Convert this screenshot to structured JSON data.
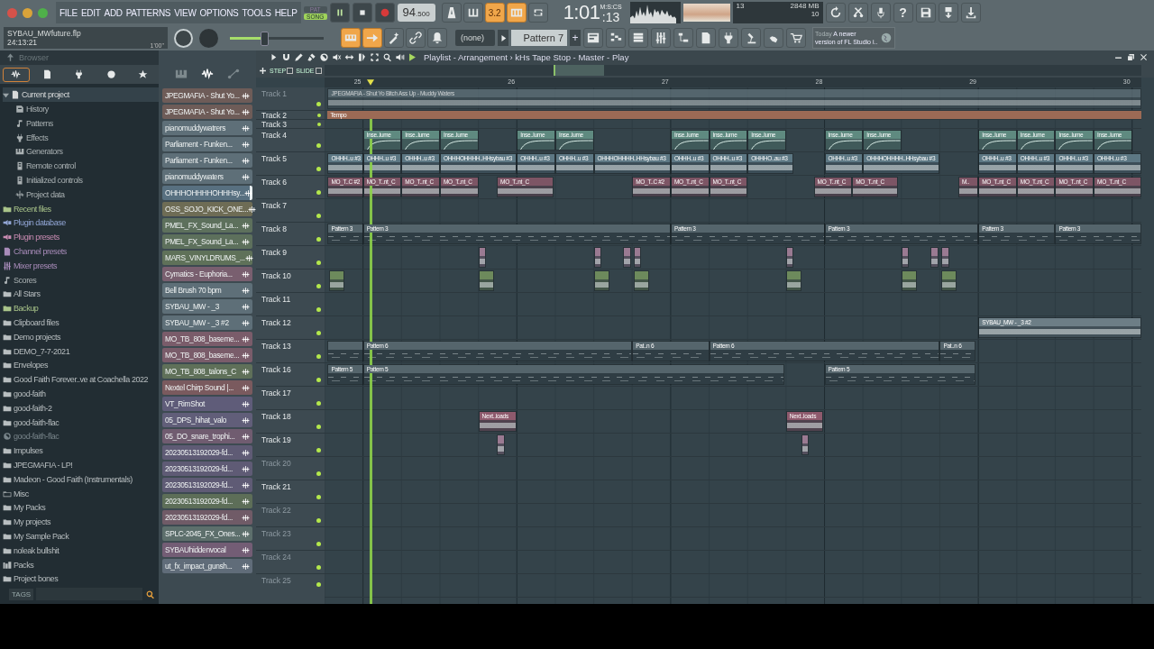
{
  "menu": [
    "FILE",
    "EDIT",
    "ADD",
    "PATTERNS",
    "VIEW",
    "OPTIONS",
    "TOOLS",
    "HELP"
  ],
  "mode_switch": [
    {
      "label": "PAT",
      "selected": false
    },
    {
      "label": "SONG",
      "selected": true
    }
  ],
  "transport": {
    "playing": true,
    "tempo_whole": "94",
    "tempo_fraction": ".500"
  },
  "transport_toggles": [
    {
      "kind": "metronome",
      "on": false
    },
    {
      "kind": "wait",
      "on": false
    },
    {
      "kind": "countdown",
      "label": "3.2",
      "on": true
    },
    {
      "kind": "step-edit",
      "on": true
    },
    {
      "kind": "loop-record",
      "on": false
    }
  ],
  "song_time": {
    "main": "1:01",
    "sub": ":13",
    "unit": "M:S:CS"
  },
  "monitor": {
    "cpu": "13",
    "memory": "2848 MB",
    "polyphony": "10"
  },
  "help_label": "?",
  "project": {
    "file": "SYBAU_MWfuture.flp",
    "time": "24:13:21",
    "length": "1'00\""
  },
  "master_pitch": {
    "level": 0.37
  },
  "record_toggles": [
    {
      "kind": "keyboard",
      "on": true
    },
    {
      "kind": "arrow",
      "on": true
    },
    {
      "kind": "wand",
      "on": false
    },
    {
      "kind": "link",
      "on": false
    },
    {
      "kind": "bell",
      "on": false
    }
  ],
  "pattern_picker": {
    "none_label": "(none)",
    "pattern": "Pattern 7",
    "add": "+"
  },
  "news": {
    "day": "Today",
    "text": "A newer version of FL Studio i.."
  },
  "browser": {
    "title": "Browser",
    "tags_label": "TAGS",
    "items": [
      {
        "label": "Current project",
        "kind": "project",
        "expanded": true,
        "children": [
          {
            "label": "History",
            "kind": "history"
          },
          {
            "label": "Patterns",
            "kind": "note"
          },
          {
            "label": "Effects",
            "kind": "plug"
          },
          {
            "label": "Generators",
            "kind": "keys"
          },
          {
            "label": "Remote control",
            "kind": "remote"
          },
          {
            "label": "Initialized controls",
            "kind": "remote"
          },
          {
            "label": "Project data",
            "kind": "data"
          }
        ]
      },
      {
        "label": "Recent files",
        "kind": "folder-green"
      },
      {
        "label": "Plugin database",
        "kind": "plugin-db"
      },
      {
        "label": "Plugin presets",
        "kind": "plugin-preset"
      },
      {
        "label": "Channel presets",
        "kind": "channel-preset"
      },
      {
        "label": "Mixer presets",
        "kind": "mixer-preset"
      },
      {
        "label": "Scores",
        "kind": "note"
      },
      {
        "label": "All Stars",
        "kind": "folder"
      },
      {
        "label": "Backup",
        "kind": "folder-green"
      },
      {
        "label": "Clipboard files",
        "kind": "folder"
      },
      {
        "label": "Demo projects",
        "kind": "folder"
      },
      {
        "label": "DEMO_7-7-2021",
        "kind": "folder"
      },
      {
        "label": "Envelopes",
        "kind": "folder"
      },
      {
        "label": "Good Faith Forever..ve at Coachella 2022",
        "kind": "folder"
      },
      {
        "label": "good-faith",
        "kind": "folder"
      },
      {
        "label": "good-faith-2",
        "kind": "folder"
      },
      {
        "label": "good-faith-flac",
        "kind": "folder"
      },
      {
        "label": "good-faith-flac",
        "kind": "missing"
      },
      {
        "label": "Impulses",
        "kind": "folder"
      },
      {
        "label": "JPEGMAFIA - LP!",
        "kind": "folder"
      },
      {
        "label": "Madeon - Good Faith (Instrumentals)",
        "kind": "folder"
      },
      {
        "label": "Misc",
        "kind": "folder-plain"
      },
      {
        "label": "My Packs",
        "kind": "folder"
      },
      {
        "label": "My projects",
        "kind": "folder"
      },
      {
        "label": "My Sample Pack",
        "kind": "folder"
      },
      {
        "label": "noleak bullshit",
        "kind": "folder"
      },
      {
        "label": "Packs",
        "kind": "packs"
      },
      {
        "label": "Project bones",
        "kind": "folder"
      }
    ]
  },
  "channels": [
    {
      "name": "JPEGMAFIA - Shut Yo...",
      "color": "#6e5c58",
      "selected": false
    },
    {
      "name": "JPEGMAFIA - Shut Yo...",
      "color": "#6e5c58",
      "selected": false
    },
    {
      "name": "pianomuddywatrers",
      "color": "#5e6f78",
      "selected": false
    },
    {
      "name": "Parliament - Funken...",
      "color": "#5e6f78",
      "selected": false
    },
    {
      "name": "Parliament - Funken...",
      "color": "#5e6f78",
      "selected": false
    },
    {
      "name": "pianomuddywaters",
      "color": "#5e6f78",
      "selected": false
    },
    {
      "name": "OHHHOHHHHOHHHsy...",
      "color": "#587080",
      "selected": true
    },
    {
      "name": "OSS_SOJO_KICK_ONE...",
      "color": "#6e6c55",
      "selected": false
    },
    {
      "name": "PMEL_FX_Sound_La...",
      "color": "#5d705c",
      "selected": false
    },
    {
      "name": "PMEL_FX_Sound_La...",
      "color": "#5d705c",
      "selected": false
    },
    {
      "name": "MARS_VINYLDRUMS_...",
      "color": "#5f7159",
      "selected": false
    },
    {
      "name": "Cymatics - Euphoria...",
      "color": "#795f6f",
      "selected": false
    },
    {
      "name": "Bell Brush 70 bpm",
      "color": "#5e6f78",
      "selected": false
    },
    {
      "name": "SYBAU_MW - _3",
      "color": "#5e6f78",
      "selected": false
    },
    {
      "name": "SYBAU_MW - _3 #2",
      "color": "#5e6f78",
      "selected": false
    },
    {
      "name": "MO_TB_808_baseme...",
      "color": "#7a5c6a",
      "selected": false
    },
    {
      "name": "MO_TB_808_baseme...",
      "color": "#7a5c6a",
      "selected": false
    },
    {
      "name": "MO_TB_808_talons_C",
      "color": "#5f7059",
      "selected": false
    },
    {
      "name": "Nextel Chirp Sound |...",
      "color": "#7a5a5e",
      "selected": false
    },
    {
      "name": "VT_RimShot",
      "color": "#5f5c79",
      "selected": false
    },
    {
      "name": "05_DPS_hihat_valo",
      "color": "#615e79",
      "selected": false
    },
    {
      "name": "05_DO_snare_trophi...",
      "color": "#705c70",
      "selected": false
    },
    {
      "name": "20230513192029-fd...",
      "color": "#5f5b75",
      "selected": false
    },
    {
      "name": "20230513192029-fd...",
      "color": "#5f5b75",
      "selected": false
    },
    {
      "name": "20230513192029-fd...",
      "color": "#5f5b75",
      "selected": false
    },
    {
      "name": "20230513192029-fd...",
      "color": "#5d6e58",
      "selected": false
    },
    {
      "name": "20230513192029-fd...",
      "color": "#705b67",
      "selected": false
    },
    {
      "name": "SPLC-2045_FX_Ones...",
      "color": "#5d6f6c",
      "selected": false
    },
    {
      "name": "SYBAUhiddenvocal",
      "color": "#735d75",
      "selected": false
    },
    {
      "name": "ut_fx_impact_gunsh...",
      "color": "#606c79",
      "selected": false
    }
  ],
  "playlist": {
    "title": "Playlist - Arrangement › kHs Tape Stop - Master - Play",
    "options": [
      {
        "label": "STEP",
        "checked": false
      },
      {
        "label": "SLIDE",
        "checked": false
      }
    ],
    "ruler": [
      "25",
      "26",
      "27",
      "28",
      "29",
      "30"
    ],
    "tracks": [
      {
        "name": "Track 1",
        "kind": "normal",
        "muted": true,
        "clips": [
          {
            "kind": "audio",
            "label": "JPEGMAFIA - Shut Yo Bitch Ass Up - Muddy Waters",
            "color": "#5f7179"
          }
        ]
      },
      {
        "name": "Track 2",
        "kind": "small",
        "muted": false,
        "clips": [
          {
            "kind": "automation",
            "label": "Tempo",
            "color": "#9c6a55"
          }
        ]
      },
      {
        "name": "Track 3",
        "kind": "small",
        "muted": false
      },
      {
        "name": "Track 4",
        "kind": "normal",
        "muted": false,
        "clips": [
          {
            "kind": "automation",
            "label": "Inse..lume",
            "color": "#5f8a80"
          },
          {
            "kind": "automation",
            "label": "Inse..lume",
            "color": "#5f8a80"
          },
          {
            "kind": "automation",
            "label": "Inse..lume",
            "color": "#5f8a80"
          },
          {
            "kind": "automation",
            "label": "Inse..lume",
            "color": "#5f8a80"
          },
          {
            "kind": "automation",
            "label": "Inse..lume",
            "color": "#5f8a80"
          },
          {
            "kind": "automation",
            "label": "Inse..lume",
            "color": "#5f8a80"
          },
          {
            "kind": "automation",
            "label": "Inse..lume",
            "color": "#5f8a80"
          },
          {
            "kind": "automation",
            "label": "Inse..lume",
            "color": "#5f8a80"
          },
          {
            "kind": "automation",
            "label": "Inse..lume",
            "color": "#5f8a80"
          },
          {
            "kind": "automation",
            "label": "Inse..lume",
            "color": "#5f8a80"
          },
          {
            "kind": "automation",
            "label": "Inse..lume",
            "color": "#5f8a80"
          },
          {
            "kind": "automation",
            "label": "Inse..lume",
            "color": "#5f8a80"
          },
          {
            "kind": "automation",
            "label": "Inse..lume",
            "color": "#5f8a80"
          },
          {
            "kind": "automation",
            "label": "Inse..lume",
            "color": "#5f8a80"
          }
        ]
      },
      {
        "name": "Track 5",
        "kind": "normal",
        "muted": false,
        "clips": [
          {
            "kind": "audio",
            "label": "OHHH..u #3",
            "color": "#5d7884"
          },
          {
            "kind": "audio",
            "label": "OHHH..u #3",
            "color": "#5d7884"
          },
          {
            "kind": "audio",
            "label": "OHHH..u #3",
            "color": "#5d7884"
          },
          {
            "kind": "audio",
            "label": "OHHHOHHHH..HHsybau #3",
            "color": "#5d7884"
          },
          {
            "kind": "audio",
            "label": "OHHH..u #3",
            "color": "#5d7884"
          },
          {
            "kind": "audio",
            "label": "OHHH..u #3",
            "color": "#5d7884"
          },
          {
            "kind": "audio",
            "label": "OHHHOHHHH..HHsybau #3",
            "color": "#5d7884"
          },
          {
            "kind": "audio",
            "label": "OHHH..u #3",
            "color": "#5d7884"
          },
          {
            "kind": "audio",
            "label": "OHHH..u #3",
            "color": "#5d7884"
          },
          {
            "kind": "audio",
            "label": "OHHHO..au #3",
            "color": "#5d7884"
          },
          {
            "kind": "audio",
            "label": "OHHH..u #3",
            "color": "#5d7884"
          },
          {
            "kind": "audio",
            "label": "OHHHOHHHH..HHsybau #3",
            "color": "#5d7884"
          },
          {
            "kind": "audio",
            "label": "OHHH..u #3",
            "color": "#5d7884"
          },
          {
            "kind": "audio",
            "label": "OHHH..u #3",
            "color": "#5d7884"
          },
          {
            "kind": "audio",
            "label": "OHHH..u #3",
            "color": "#5d7884"
          },
          {
            "kind": "audio",
            "label": "OHHH..u #3",
            "color": "#5d7884"
          }
        ]
      },
      {
        "name": "Track 6",
        "kind": "normal",
        "muted": false,
        "clips": [
          {
            "kind": "audio",
            "label": "MO_T..C #2",
            "color": "#7d5565"
          },
          {
            "kind": "audio",
            "label": "MO_T..nt_C",
            "color": "#7d5565"
          },
          {
            "kind": "audio",
            "label": "MO_T..nt_C",
            "color": "#7d5565"
          },
          {
            "kind": "audio",
            "label": "MO_T..nt_C",
            "color": "#7d5565"
          },
          {
            "kind": "audio",
            "label": "MO_T..nt_C",
            "color": "#7d5565"
          },
          {
            "kind": "audio",
            "label": "MO_T..C #2",
            "color": "#7d5565"
          },
          {
            "kind": "audio",
            "label": "MO_T..nt_C",
            "color": "#7d5565"
          },
          {
            "kind": "audio",
            "label": "MO_T..nt_C",
            "color": "#7d5565"
          },
          {
            "kind": "audio",
            "label": "MO_T..nt_C",
            "color": "#7d5565"
          },
          {
            "kind": "audio",
            "label": "MO_T..nt_C",
            "color": "#7d5565"
          },
          {
            "kind": "audio",
            "label": "M..",
            "color": "#7d5565"
          },
          {
            "kind": "audio",
            "label": "MO_T..nt_C",
            "color": "#7d5565"
          },
          {
            "kind": "audio",
            "label": "MO_T..nt_C",
            "color": "#7d5565"
          },
          {
            "kind": "audio",
            "label": "MO_T..nt_C",
            "color": "#7d5565"
          },
          {
            "kind": "audio",
            "label": "MO_T..nt_C",
            "color": "#7d5565"
          }
        ]
      },
      {
        "name": "Track 7",
        "kind": "normal",
        "muted": false
      },
      {
        "name": "Track 8",
        "kind": "normal",
        "muted": false,
        "clips": [
          {
            "kind": "pattern",
            "label": "Pattern 3",
            "color": "#55656c"
          },
          {
            "kind": "pattern",
            "label": "Pattern 3",
            "color": "#55656c"
          },
          {
            "kind": "pattern",
            "label": "Pattern 3",
            "color": "#55656c"
          },
          {
            "kind": "pattern",
            "label": "Pattern 3",
            "color": "#55656c"
          },
          {
            "kind": "pattern",
            "label": "Pattern 3",
            "color": "#55656c"
          },
          {
            "kind": "pattern",
            "label": "Pattern 3",
            "color": "#55656c"
          }
        ]
      },
      {
        "name": "Track 9",
        "kind": "normal",
        "muted": false,
        "clips": [
          {
            "kind": "audio",
            "color": "#9a7a92"
          },
          {
            "kind": "audio",
            "color": "#9a7a92"
          },
          {
            "kind": "audio",
            "color": "#9a7a92"
          },
          {
            "kind": "audio",
            "color": "#9a7a92"
          },
          {
            "kind": "audio",
            "color": "#9a7a92"
          },
          {
            "kind": "audio",
            "color": "#9a7a92"
          },
          {
            "kind": "audio",
            "color": "#9a7a92"
          },
          {
            "kind": "audio",
            "color": "#9a7a92"
          }
        ]
      },
      {
        "name": "Track 10",
        "kind": "normal",
        "muted": false,
        "clips": [
          {
            "kind": "audio",
            "color": "#6d8a5c"
          },
          {
            "kind": "audio",
            "color": "#6d8a5c"
          },
          {
            "kind": "audio",
            "color": "#6d8a5c"
          },
          {
            "kind": "audio",
            "color": "#6d8a5c"
          },
          {
            "kind": "audio",
            "color": "#6d8a5c"
          },
          {
            "kind": "audio",
            "color": "#6d8a5c"
          },
          {
            "kind": "audio",
            "color": "#6d8a5c"
          }
        ]
      },
      {
        "name": "Track 11",
        "kind": "normal",
        "muted": false
      },
      {
        "name": "Track 12",
        "kind": "normal",
        "muted": false,
        "clips": [
          {
            "kind": "audio",
            "label": "SYBAU_MW - _3 #2",
            "color": "#6d7e86"
          }
        ]
      },
      {
        "name": "Track 13",
        "kind": "normal",
        "muted": false,
        "clips": [
          {
            "kind": "pattern",
            "color": "#55656c"
          },
          {
            "kind": "pattern",
            "label": "Pattern 6",
            "color": "#55656c"
          },
          {
            "kind": "pattern",
            "label": "Pat..n 6",
            "color": "#55656c"
          },
          {
            "kind": "pattern",
            "label": "Pattern 6",
            "color": "#55656c"
          },
          {
            "kind": "pattern",
            "label": "Pat..n 6",
            "color": "#55656c"
          }
        ]
      },
      {
        "name": "Track 16",
        "kind": "normal",
        "muted": false,
        "clips": [
          {
            "kind": "pattern",
            "label": "Pattern 5",
            "color": "#55656c"
          },
          {
            "kind": "pattern",
            "label": "Pattern 5",
            "color": "#55656c"
          },
          {
            "kind": "pattern",
            "label": "Pattern 5",
            "color": "#55656c"
          }
        ]
      },
      {
        "name": "Track 17",
        "kind": "normal",
        "muted": false
      },
      {
        "name": "Track 18",
        "kind": "normal",
        "muted": false,
        "clips": [
          {
            "kind": "audio",
            "label": "Next..loads",
            "color": "#8e5a6d"
          },
          {
            "kind": "audio",
            "label": "Next..loads",
            "color": "#8e5a6d"
          }
        ]
      },
      {
        "name": "Track 19",
        "kind": "normal",
        "muted": false,
        "clips": [
          {
            "kind": "audio",
            "color": "#9a7a92"
          },
          {
            "kind": "audio",
            "color": "#9a7a92"
          }
        ]
      },
      {
        "name": "Track 20",
        "kind": "normal",
        "muted": true
      },
      {
        "name": "Track 21",
        "kind": "normal",
        "muted": false
      },
      {
        "name": "Track 22",
        "kind": "normal",
        "muted": true
      },
      {
        "name": "Track 23",
        "kind": "normal",
        "muted": true
      },
      {
        "name": "Track 24",
        "kind": "normal",
        "muted": true
      },
      {
        "name": "Track 25",
        "kind": "normal",
        "muted": true
      }
    ]
  }
}
